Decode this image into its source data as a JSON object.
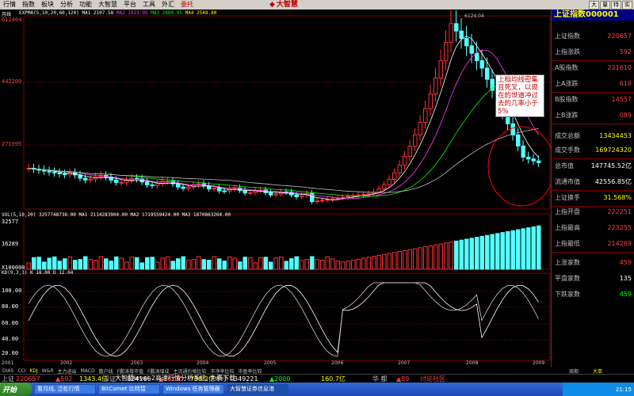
{
  "menubar": {
    "items": [
      "行情",
      "指数",
      "板块",
      "分析",
      "功能",
      "大智慧",
      "平台",
      "工具",
      "外汇",
      "委托"
    ],
    "brand": "大智慧",
    "right_buttons": [
      "大",
      "量",
      "特",
      "实"
    ]
  },
  "chart": {
    "period": "月线",
    "ma_line": {
      "label": "EXPMA",
      "params": "(5,10,20,60,120)",
      "values": [
        "MA1 2107.58",
        "MA2 1923.95",
        "MA3 2800.95",
        "MA4 2548.80"
      ]
    },
    "vol_line": "VOL(5,10,20)  3257748736.00  MA1 2114283904.00  MA2 1719559424.00  MA3 1870863264.00",
    "kd_line": "KD(9,3,3)  K 18.00  D 12.04",
    "price_axis": [
      "612404",
      "442200",
      "271995"
    ],
    "vol_axis": [
      "32577",
      "16289",
      "X100000"
    ],
    "kd_axis": [
      "100.00",
      "80.00",
      "60.00",
      "40.00",
      "20.00"
    ],
    "x_axis": [
      "2001",
      "2002",
      "2003",
      "2004",
      "2005",
      "2006",
      "2007",
      "2008",
      "2009"
    ],
    "peak_label": "6124.04",
    "annotation": "上档均线密集且死叉，以现在的世道冲过去的几率小于5%"
  },
  "chart_data": {
    "type": "candlestick",
    "x": [
      "2001",
      "2002",
      "2003",
      "2004",
      "2005",
      "2006",
      "2007",
      "2008",
      "2009"
    ],
    "ylim": [
      1000,
      6124
    ]
  },
  "panel": {
    "title": "上证指数000001",
    "rows": [
      {
        "label": "上证指数",
        "value": "220657",
        "color": "#ff4040"
      },
      {
        "label": "上指涨跌",
        "value": "592",
        "color": "#ff4040"
      },
      {
        "label": "A股指数",
        "value": "231610",
        "color": "#ff4040"
      },
      {
        "label": "上A涨跌",
        "value": "618",
        "color": "#ff4040"
      },
      {
        "label": "B股指数",
        "value": "14557",
        "color": "#ff4040"
      },
      {
        "label": "上B涨跌",
        "value": "089",
        "color": "#ff4040"
      },
      {
        "label": "成交总额",
        "value": "13434453",
        "color": "#ffff00"
      },
      {
        "label": "成交手数",
        "value": "169724320",
        "color": "#ffff00"
      },
      {
        "label": "总市值",
        "value": "147745.52亿",
        "color": "#ffffff"
      },
      {
        "label": "流通市值",
        "value": "42556.85亿",
        "color": "#ffffff"
      },
      {
        "label": "上证换手",
        "value": "31.568%",
        "color": "#ffff00"
      },
      {
        "label": "上指开盘",
        "value": "222251",
        "color": "#ff4040"
      },
      {
        "label": "上指最高",
        "value": "223255",
        "color": "#ff4040"
      },
      {
        "label": "上指最低",
        "value": "214269",
        "color": "#ff4040"
      },
      {
        "label": "上涨家数",
        "value": "459",
        "color": "#ff4040"
      },
      {
        "label": "平盘家数",
        "value": "135",
        "color": "#ffffff"
      },
      {
        "label": "下跌家数",
        "value": "459",
        "color": "#00ff00"
      }
    ]
  },
  "ticker": {
    "items": [
      "DIAS",
      "CCI",
      "KDJ",
      "W&R",
      "主力进出",
      "MACD",
      "散户线",
      "F鹏涛增市值",
      "F鹏涛增成",
      "主流通价格比较",
      "市净率比较",
      "市盈率比较"
    ],
    "active": "KDJ",
    "right1": "周期",
    "right2": "大单"
  },
  "statusbar": {
    "items": [
      {
        "text": "上证",
        "color": "#c0c0c0"
      },
      {
        "text": "220657",
        "color": "#ff4040"
      },
      {
        "text": "▲592",
        "color": "#ff4040"
      },
      {
        "text": "1343.4亿",
        "color": "#ffff00"
      },
      {
        "text": "深证",
        "color": "#c0c0c0"
      },
      {
        "text": "824166",
        "color": "#ffffff"
      },
      {
        "text": "▲16135",
        "color": "#ff4040"
      },
      {
        "text": "738.2亿",
        "color": "#ffff00"
      },
      {
        "text": "中小",
        "color": "#c0c0c0"
      },
      {
        "text": "349221",
        "color": "#ffffff"
      },
      {
        "text": "▲2000",
        "color": "#00ff00"
      },
      {
        "text": "160.7亿",
        "color": "#ffff00"
      },
      {
        "text": "华 都",
        "color": "#c0c0c0"
      },
      {
        "text": "▲89",
        "color": "#ff4040"
      },
      {
        "text": "讨论社区",
        "color": "#ff4040"
      }
    ]
  },
  "taskbar": {
    "start": "开始",
    "buttons": [
      "看月线, 泛松行情",
      "BitComet 比特彗",
      "Windows 任务管理器",
      "大智慧证券信息港"
    ],
    "notice": "大智慧level-2高速行情分析系统, 免费下载",
    "clock": "21:15"
  }
}
